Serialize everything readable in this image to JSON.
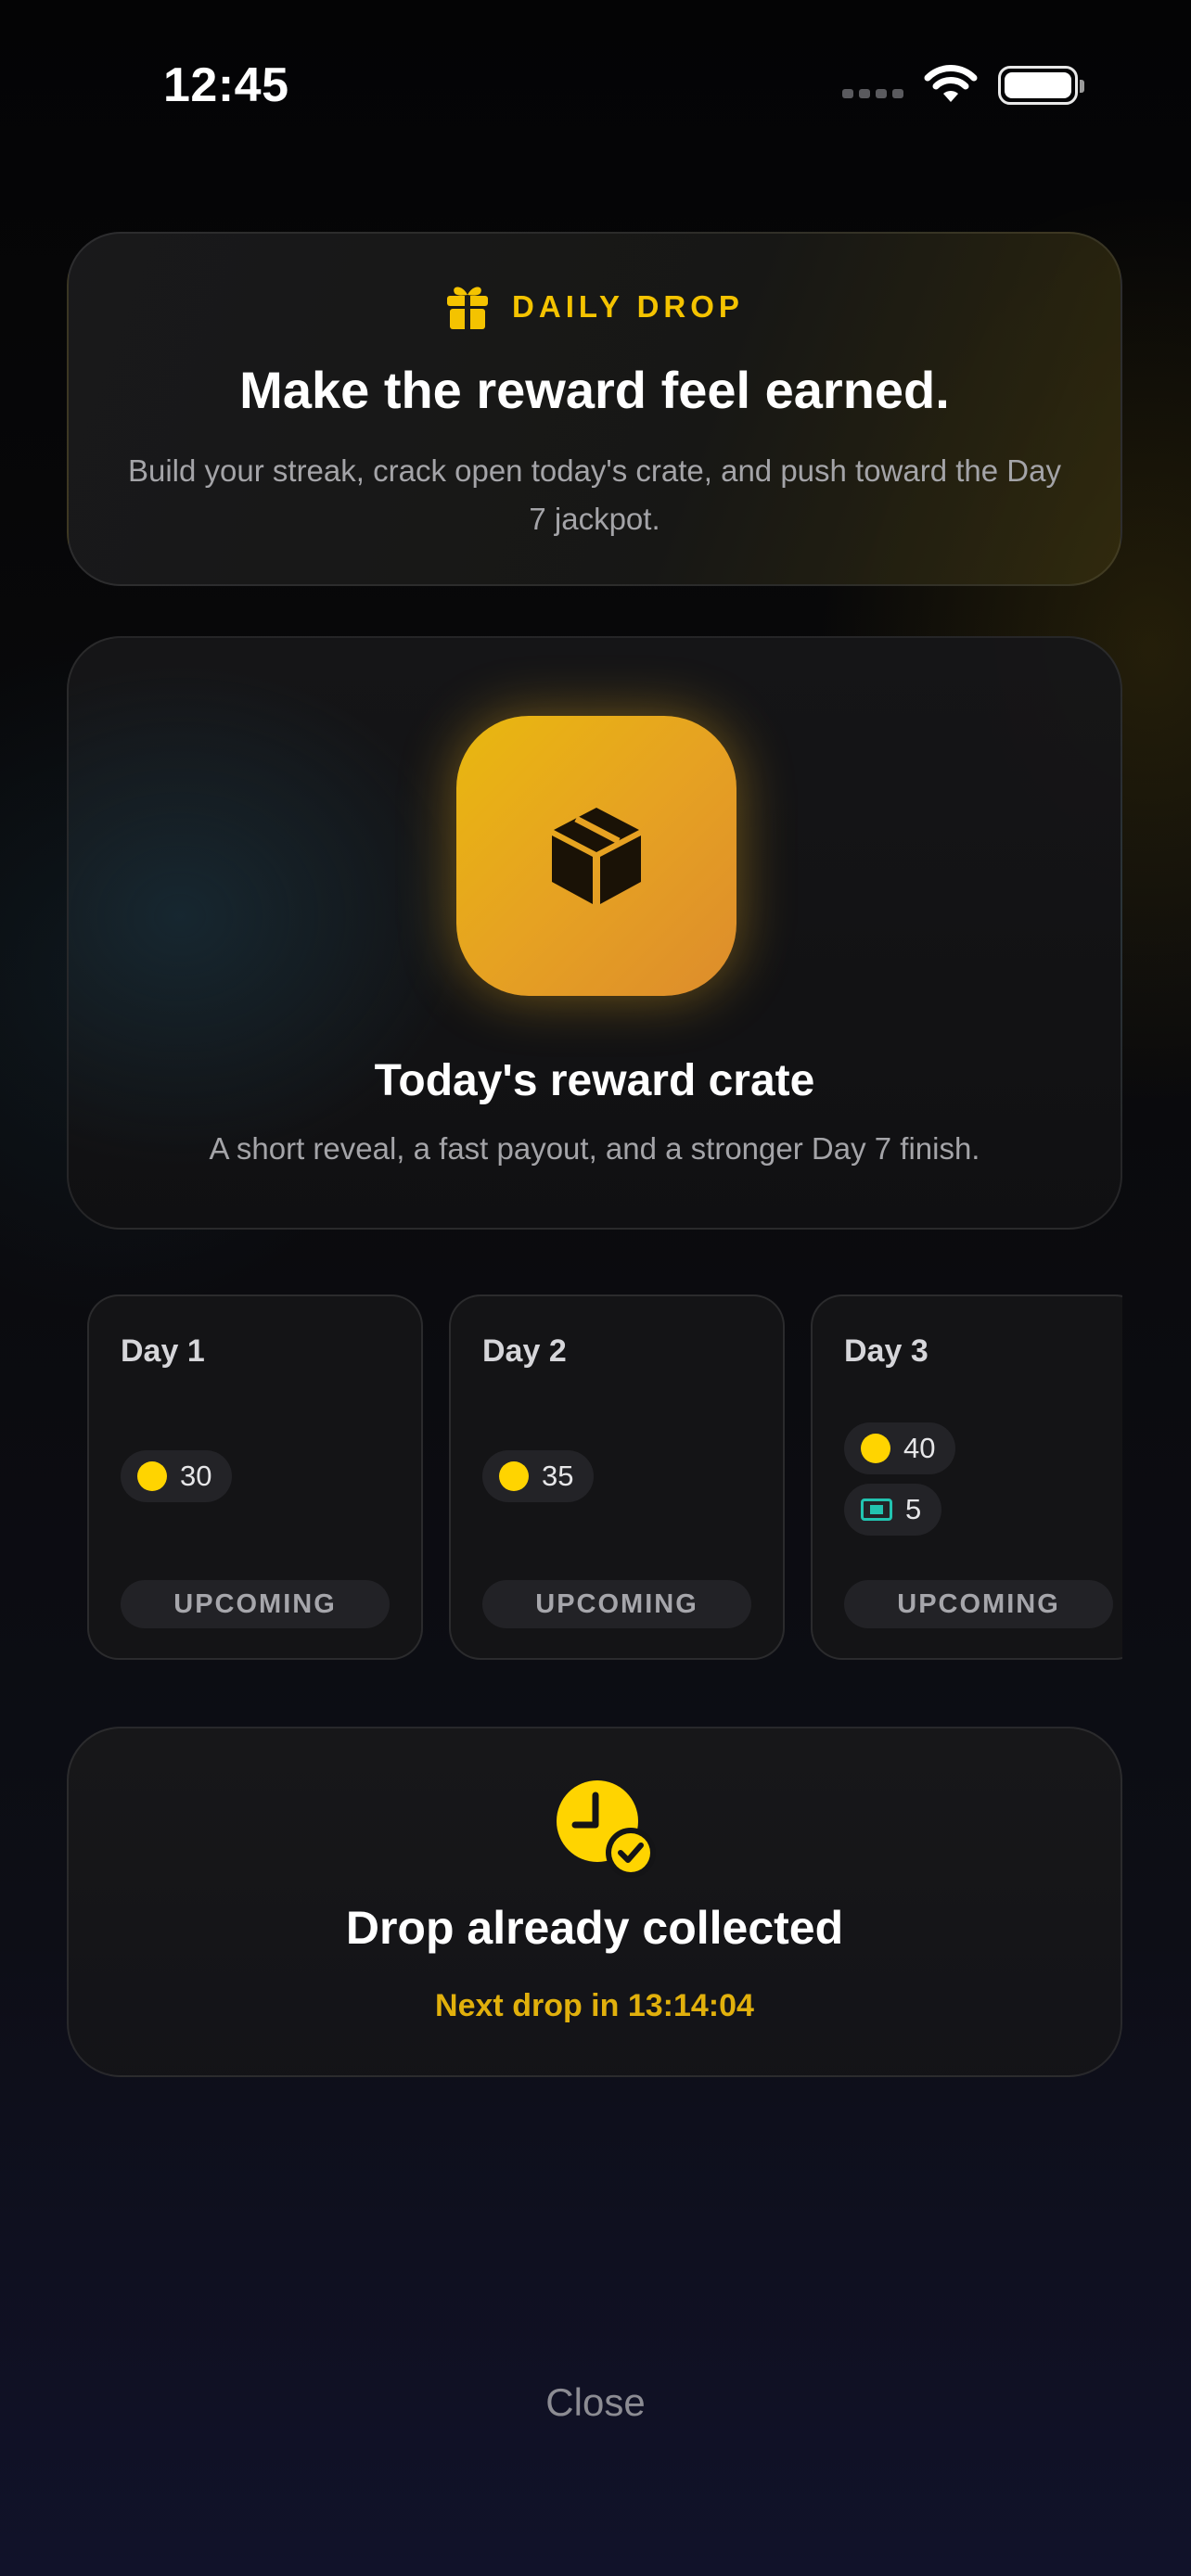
{
  "status_bar": {
    "time": "12:45"
  },
  "header": {
    "eyebrow": "DAILY DROP",
    "title": "Make the reward feel earned.",
    "subtitle": "Build your streak, crack open today's crate, and push toward the Day 7 jackpot."
  },
  "crate": {
    "title": "Today's reward crate",
    "subtitle": "A short reveal, a fast payout, and a stronger Day 7 finish."
  },
  "days": [
    {
      "label": "Day 1",
      "rewards": [
        {
          "icon": "coin-icon",
          "amount": "30"
        }
      ],
      "status": "UPCOMING"
    },
    {
      "label": "Day 2",
      "rewards": [
        {
          "icon": "coin-icon",
          "amount": "35"
        }
      ],
      "status": "UPCOMING"
    },
    {
      "label": "Day 3",
      "rewards": [
        {
          "icon": "coin-icon",
          "amount": "40"
        },
        {
          "icon": "ticket-icon",
          "amount": "5"
        }
      ],
      "status": "UPCOMING"
    }
  ],
  "collected": {
    "title": "Drop already collected",
    "next_drop": "Next drop in 13:14:04"
  },
  "footer": {
    "close_label": "Close"
  },
  "colors": {
    "accent": "#f4c300",
    "coin": "#ffd400",
    "ticket": "#22c3b0",
    "crate_gradient_start": "#e9b80f",
    "crate_gradient_end": "#dd8c2c"
  }
}
